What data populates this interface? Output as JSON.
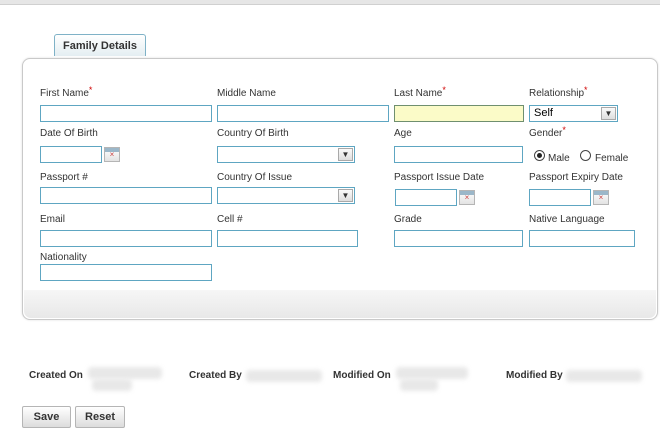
{
  "tab": {
    "label": "Family Details"
  },
  "form": {
    "first_name": {
      "label": "First Name",
      "value": ""
    },
    "middle_name": {
      "label": "Middle Name",
      "value": ""
    },
    "last_name": {
      "label": "Last Name",
      "value": ""
    },
    "relationship": {
      "label": "Relationship",
      "value": "Self"
    },
    "dob": {
      "label": "Date Of Birth",
      "value": ""
    },
    "country_birth": {
      "label": "Country Of Birth",
      "value": ""
    },
    "age": {
      "label": "Age",
      "value": ""
    },
    "gender": {
      "label": "Gender",
      "male": "Male",
      "female": "Female",
      "selected": "Male"
    },
    "passport": {
      "label": "Passport #",
      "value": ""
    },
    "country_issue": {
      "label": "Country Of Issue",
      "value": ""
    },
    "passport_issue": {
      "label": "Passport Issue Date",
      "value": ""
    },
    "passport_expiry": {
      "label": "Passport Expiry Date",
      "value": ""
    },
    "email": {
      "label": "Email",
      "value": ""
    },
    "cell": {
      "label": "Cell #",
      "value": ""
    },
    "grade": {
      "label": "Grade",
      "value": ""
    },
    "native_language": {
      "label": "Native Language",
      "value": ""
    },
    "nationality": {
      "label": "Nationality",
      "value": ""
    },
    "required_mark": "*"
  },
  "audit": {
    "created_on": "Created On",
    "created_by": "Created By",
    "modified_on": "Modified On",
    "modified_by": "Modified By"
  },
  "buttons": {
    "save": "Save",
    "reset": "Reset"
  },
  "icons": {
    "calendar": "calendar-icon",
    "dropdown": "chevron-down-icon",
    "radio": "radio-icon"
  }
}
